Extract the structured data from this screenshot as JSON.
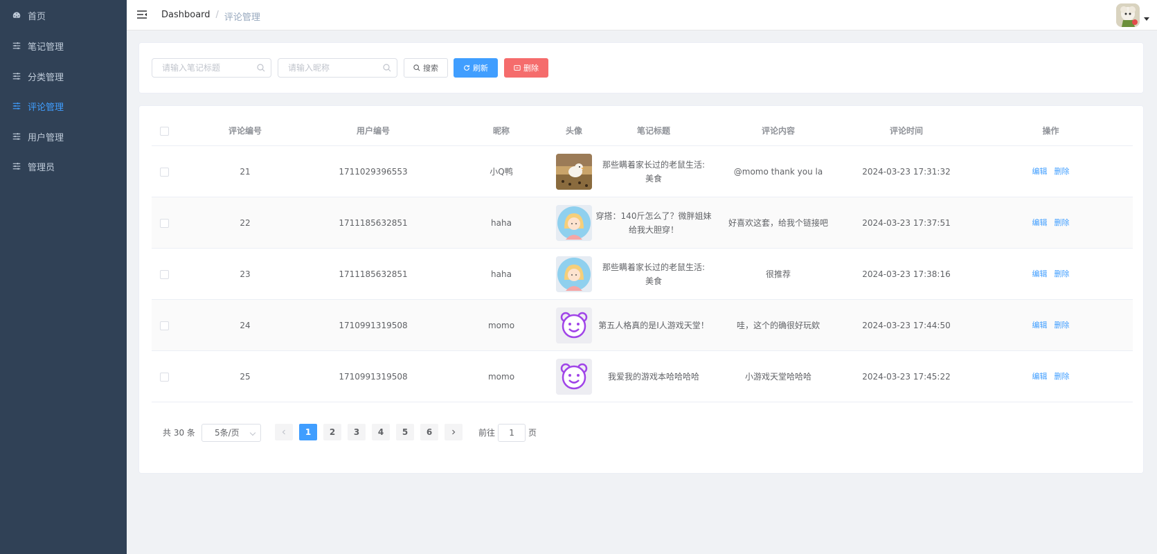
{
  "sidebar": {
    "items": [
      {
        "label": "首页",
        "icon": "dashboard-icon",
        "active": false
      },
      {
        "label": "笔记管理",
        "icon": "sliders-icon",
        "active": false
      },
      {
        "label": "分类管理",
        "icon": "sliders-icon",
        "active": false
      },
      {
        "label": "评论管理",
        "icon": "sliders-icon",
        "active": true
      },
      {
        "label": "用户管理",
        "icon": "sliders-icon",
        "active": false
      },
      {
        "label": "管理员",
        "icon": "sliders-icon",
        "active": false
      }
    ],
    "bg_color": "#304156",
    "active_color": "#409eff"
  },
  "header": {
    "breadcrumb_home": "Dashboard",
    "breadcrumb_sep": "/",
    "breadcrumb_current": "评论管理"
  },
  "search": {
    "title_placeholder": "请输入笔记标题",
    "nickname_placeholder": "请输入昵称",
    "search_label": "搜索",
    "refresh_label": "刷新",
    "delete_label": "删除"
  },
  "table": {
    "headers": [
      "评论编号",
      "用户编号",
      "昵称",
      "头像",
      "笔记标题",
      "评论内容",
      "评论时间",
      "操作"
    ],
    "rows": [
      {
        "id": "21",
        "user_id": "1711029396553",
        "nickname": "小Q鸭",
        "avatar": "photo-avatar",
        "title_line1": "那些瞒着家长过的老鼠生活:",
        "title_line2": "美食",
        "content": "@momo thank you la",
        "time": "2024-03-23 17:31:32"
      },
      {
        "id": "22",
        "user_id": "1711185632851",
        "nickname": "haha",
        "avatar": "girl-avatar",
        "title_line1": "穿搭：140斤怎么了？微胖姐妹",
        "title_line2": "给我大胆穿！",
        "content": "好喜欢这套，给我个链接吧",
        "time": "2024-03-23 17:37:51"
      },
      {
        "id": "23",
        "user_id": "1711185632851",
        "nickname": "haha",
        "avatar": "girl-avatar",
        "title_line1": "那些瞒着家长过的老鼠生活:",
        "title_line2": "美食",
        "content": "很推荐",
        "time": "2024-03-23 17:38:16"
      },
      {
        "id": "24",
        "user_id": "1710991319508",
        "nickname": "momo",
        "avatar": "bear-face-avatar",
        "title_line1": "第五人格真的是I人游戏天堂！",
        "title_line2": "",
        "content": "哇，这个的确很好玩欸",
        "time": "2024-03-23 17:44:50"
      },
      {
        "id": "25",
        "user_id": "1710991319508",
        "nickname": "momo",
        "avatar": "bear-face-avatar",
        "title_line1": "我爱我的游戏本哈哈哈哈",
        "title_line2": "",
        "content": "小游戏天堂哈哈哈",
        "time": "2024-03-23 17:45:22"
      }
    ],
    "edit_label": "编辑",
    "delete_label": "删除"
  },
  "pagination": {
    "total_label": "共 30 条",
    "page_size": "5条/页",
    "pages": [
      "1",
      "2",
      "3",
      "4",
      "5",
      "6"
    ],
    "current_page": "1",
    "goto_prefix": "前往",
    "goto_value": "1",
    "goto_suffix": "页"
  }
}
